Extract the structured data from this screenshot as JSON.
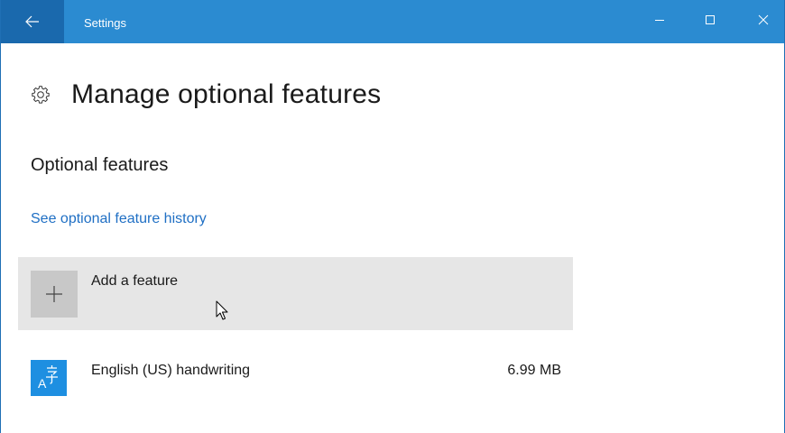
{
  "window": {
    "title": "Settings",
    "back_icon": "back-arrow-icon",
    "controls": [
      "minimize-icon",
      "maximize-icon",
      "close-icon"
    ],
    "accent_color": "#2b8bd1",
    "back_button_color": "#1a69ad"
  },
  "page": {
    "title": "Manage optional features",
    "icon": "gear-icon"
  },
  "section": {
    "heading": "Optional features",
    "history_link": "See optional feature history"
  },
  "add_feature": {
    "label": "Add a feature",
    "icon": "plus-icon"
  },
  "features": [
    {
      "name": "English (US) handwriting",
      "size": "6.99 MB",
      "icon": "language-icon",
      "icon_color": "#1e8fe1"
    }
  ],
  "link_color": "#1f6fc4"
}
